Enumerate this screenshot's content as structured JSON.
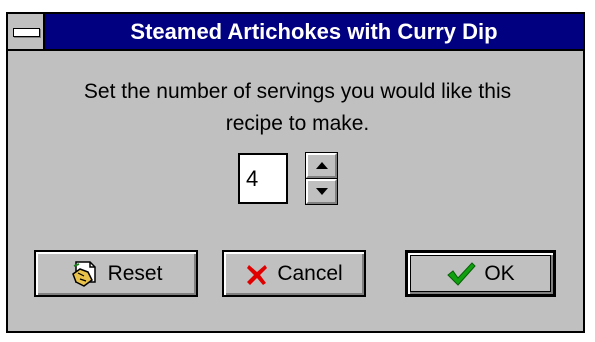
{
  "window": {
    "title": "Steamed Artichokes with Curry Dip"
  },
  "prompt": {
    "line1": "Set the number of servings you would like this",
    "line2": "recipe to make."
  },
  "servings": {
    "value": "4"
  },
  "buttons": {
    "reset_label": "Reset",
    "cancel_label": "Cancel",
    "ok_label": "OK"
  },
  "icons": {
    "reset": "reset-icon",
    "cancel": "red-x-icon",
    "ok": "green-checkmark-icon",
    "sysmenu": "system-menu-icon"
  },
  "colors": {
    "titlebar": "#000080",
    "dialog_face": "#c0c0c0",
    "cancel_x": "#e00000",
    "ok_check": "#10a010"
  }
}
